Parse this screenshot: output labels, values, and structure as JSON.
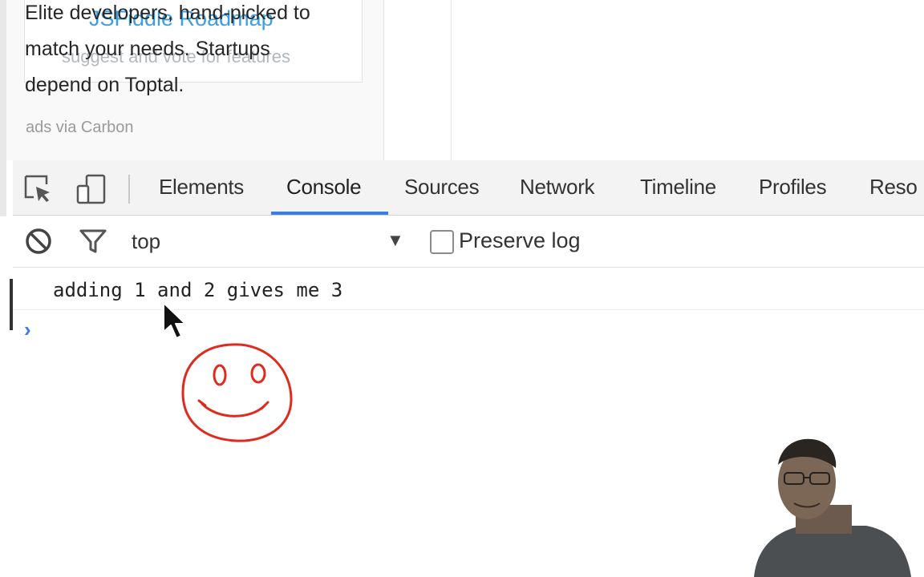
{
  "page": {
    "ad_text_lines": [
      "Elite developers, hand-picked to",
      "match your needs. Startups",
      "depend on Toptal."
    ],
    "ads_via": "ads via Carbon",
    "roadmap_title": "JSFiddle Roadmap",
    "roadmap_subtitle": "suggest and vote for features"
  },
  "devtools": {
    "tabs": [
      {
        "label": "Elements"
      },
      {
        "label": "Console",
        "active": true
      },
      {
        "label": "Sources"
      },
      {
        "label": "Network"
      },
      {
        "label": "Timeline"
      },
      {
        "label": "Profiles"
      },
      {
        "label": "Reso"
      }
    ],
    "accent": "#3c7de0",
    "console_toolbar": {
      "context": "top",
      "preserve_log_label": "Preserve log",
      "preserve_log_checked": false
    },
    "messages": [
      {
        "text": "adding 1 and 2 gives me 3"
      }
    ],
    "prompt_symbol": "›"
  },
  "icons": [
    "inspect-element-icon",
    "device-mode-icon",
    "clear-console-icon",
    "filter-icon",
    "dropdown-arrow-icon",
    "mouse-cursor-icon"
  ]
}
